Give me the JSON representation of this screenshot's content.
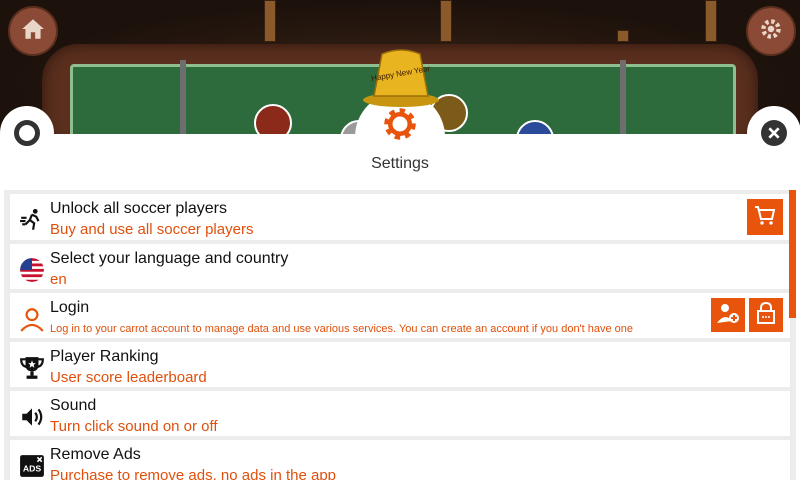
{
  "header": {
    "title": "Settings"
  },
  "colors": {
    "accent": "#e8540c",
    "panel": "#ffffff",
    "list_bg": "#ececec"
  },
  "icons": {
    "home": "home-icon",
    "game_settings": "gear-icon",
    "help": "lifebuoy-icon",
    "close": "close-icon",
    "settings": "gear-icon"
  },
  "hat_text": "Happy New Year",
  "settings": {
    "items": [
      {
        "title": "Unlock all soccer players",
        "subtitle": "Buy and use all soccer players",
        "icon": "running-man-icon"
      },
      {
        "title": "Select your language and country",
        "subtitle": "en",
        "icon": "us-flag-icon"
      },
      {
        "title": "Login",
        "subtitle": "Log in to your carrot account to manage data and use various services. You can create an account if you don't have one",
        "icon": "user-icon"
      },
      {
        "title": "Player Ranking",
        "subtitle": "User score leaderboard",
        "icon": "trophy-icon"
      },
      {
        "title": "Sound",
        "subtitle": "Turn click sound on or off",
        "icon": "speaker-icon"
      },
      {
        "title": "Remove Ads",
        "subtitle": "Purchase to remove ads, no ads in the app",
        "icon": "ads-icon"
      }
    ],
    "actions": {
      "buy": "cart-icon",
      "add_account": "add-user-icon",
      "forgot_password": "lock-question-icon"
    }
  }
}
